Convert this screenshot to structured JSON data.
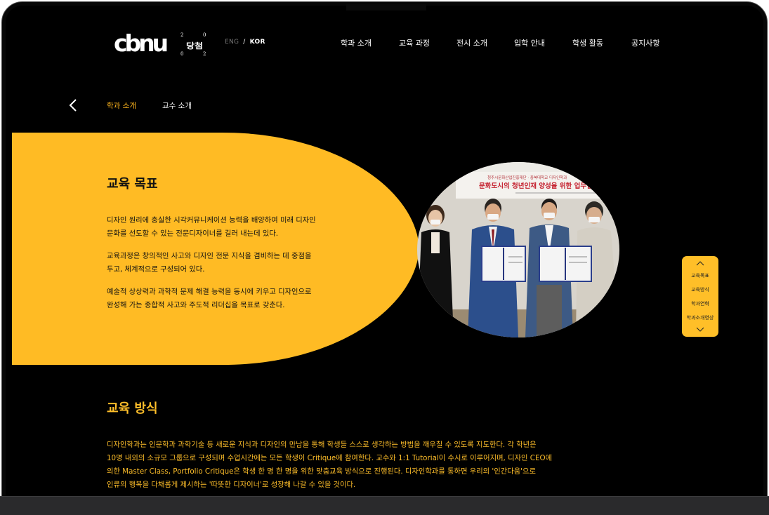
{
  "header": {
    "logo_text": "cbnu",
    "logo2_digits": [
      "2",
      "0",
      "0",
      "2"
    ],
    "logo2_text": "당첨",
    "lang_eng": "ENG",
    "lang_sep": "/",
    "lang_kor": "KOR",
    "nav": [
      "학과 소개",
      "교육 과정",
      "전시 소개",
      "입학 안내",
      "학생 활동",
      "공지사항"
    ]
  },
  "subnav": {
    "active": "학과 소개",
    "inactive": "교수 소개"
  },
  "goal": {
    "title": "교육 목표",
    "paragraphs": [
      [
        "디자인 원리에 충실한 시각커뮤니케이션 능력을 배양하여 미래 디자인",
        "문화를 선도할 수 있는 전문디자이너를 길러 내는데 있다."
      ],
      [
        "교육과정은 창의적인 사고와 디자인 전문 지식을 겸비하는 데 중점을",
        "두고, 체계적으로 구성되어 있다."
      ],
      [
        "예술적 상상력과 과학적 문제 해결 능력을 동시에 키우고 디자인으로",
        "완성해 가는 종합적 사고와 주도적 리더십을 목표로 갖춘다."
      ]
    ]
  },
  "photo": {
    "banner_text": "문화도시의 청년인재 양성을 위한 업무협",
    "banner_small": "청주시문화산업진흥재단 · 충북대학교 디자인학과"
  },
  "sidenav": {
    "items": [
      "교육목표",
      "교육방식",
      "학과연혁",
      "학과소개영상"
    ]
  },
  "method": {
    "title": "교육 방식",
    "lines": [
      "디자인학과는 인문학과 과학기술 등 새로운 지식과 디자인의 만남을 통해 학생들 스스로 생각하는 방법을 깨우칠 수 있도록 지도한다. 각 학년은",
      "10명 내외의 소규모 그룹으로 구성되며 수업시간에는 모든 학생이 Critique에 참여한다. 교수와 1:1 Tutorial이 수시로 이루어지며, 디자인 CEO에",
      "의한 Master Class, Portfolio Critique은 학생 한 명 한 명을 위한 맞춤교육 방식으로 진행된다. 디자인학과를 통하면 우리의 '인간다움'으로",
      "인류의 행복을 다채롭게 제시하는 '따뜻한 디자이너'로 성장해 나갈 수 있을 것이다."
    ]
  },
  "colors": {
    "accent": "#ffbb24",
    "background": "#000000",
    "text_light": "#ffffff"
  }
}
